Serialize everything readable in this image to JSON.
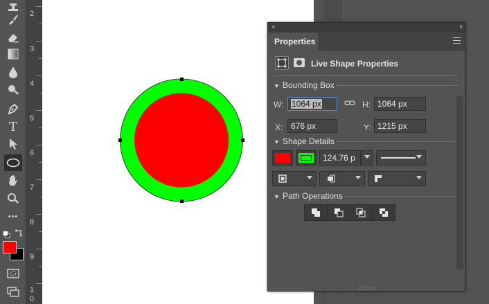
{
  "rulers": {
    "vertical": [
      "2",
      "3",
      "4",
      "5",
      "6",
      "7",
      "8",
      "9",
      "1",
      "0"
    ]
  },
  "tools": [
    {
      "icon": "stamp-icon"
    },
    {
      "icon": "history-brush-icon"
    },
    {
      "icon": "eraser-icon"
    },
    {
      "icon": "gradient-icon"
    },
    {
      "icon": "blur-drop-icon"
    },
    {
      "icon": "dodge-icon"
    },
    {
      "icon": "pen-icon"
    },
    {
      "icon": "type-icon",
      "glyph": "T"
    },
    {
      "icon": "path-selection-icon"
    },
    {
      "icon": "ellipse-icon",
      "active": true
    },
    {
      "icon": "hand-icon"
    },
    {
      "icon": "zoom-icon"
    },
    {
      "icon": "more-tools-icon",
      "glyph": "•••"
    }
  ],
  "colors": {
    "foreground": "#ff0000",
    "background": "#000000",
    "shape_fill": "#ff0000",
    "shape_stroke": "#00ff00",
    "canvas": "#ffffff",
    "panel_bg": "#535353",
    "focus_blue": "#4a8fd9"
  },
  "panel": {
    "title": "Properties",
    "close_glyph": "×",
    "collapse_glyph": "‹‹",
    "heading": "Live Shape Properties",
    "bounding_box": {
      "label": "Bounding Box",
      "w_label": "W:",
      "w_value": "1064 px",
      "h_label": "H:",
      "h_value": "1064 px",
      "x_label": "X:",
      "x_value": "676 px",
      "y_label": "Y:",
      "y_value": "1215 px"
    },
    "shape_details": {
      "label": "Shape Details",
      "stroke_width": "124.76 p"
    },
    "path_operations": {
      "label": "Path Operations"
    }
  }
}
